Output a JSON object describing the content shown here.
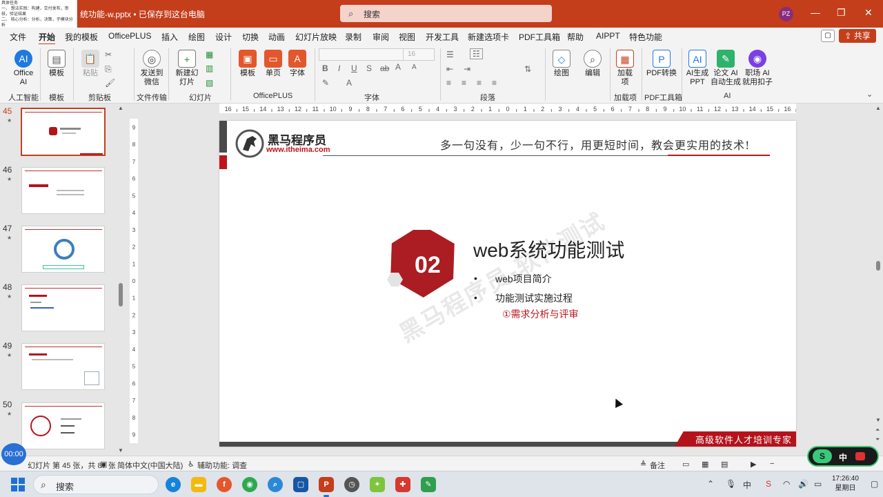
{
  "titlebar": {
    "filename": "统功能-w.pptx • 已保存到这台电脑",
    "search_placeholder": "搜索",
    "avatar": "PZ",
    "minimize": "—",
    "restore": "❐",
    "close": "✕",
    "popup_lines": [
      "具体任务",
      "一、 想法实践：构建，交付发布，审核，验证结果",
      "二、 核心分析：分析，决策，子模块分析"
    ]
  },
  "menu": {
    "tabs": [
      "文件",
      "开始",
      "我的模板",
      "OfficePLUS",
      "插入",
      "绘图",
      "设计",
      "切换",
      "动画",
      "幻灯片放映",
      "录制",
      "审阅",
      "视图",
      "开发工具",
      "新建选项卡",
      "PDF工具箱",
      "帮助",
      "AIPPT",
      "特色功能"
    ],
    "active": "开始",
    "share": "共享"
  },
  "ribbon": {
    "buttons": {
      "office_ai": "Office AI",
      "template": "模板",
      "paste": "粘贴",
      "send_wechat": "发送到微信",
      "new_slide": "新建幻灯片",
      "op_template": "模板",
      "single_page": "单页",
      "font_btn": "字体",
      "draw": "绘图",
      "edit": "编辑",
      "addins": "加载项",
      "pdf_convert": "PDF转换",
      "ai_ppt": "AI生成PPT",
      "lunwen_ai": "论文 AI自动生成",
      "zhichang_ai": "职场 AI就用扣子"
    },
    "groups": {
      "ai": "人工智能",
      "template": "模板",
      "clipboard": "剪贴板",
      "file_transfer": "文件传输",
      "slides": "幻灯片",
      "officeplus": "OfficePLUS",
      "font": "字体",
      "paragraph": "段落",
      "addins": "加载项",
      "pdf": "PDF工具箱",
      "ai2": "AI"
    },
    "font_size": "16",
    "format_buttons": [
      "B",
      "I",
      "U",
      "S",
      "ab",
      "A",
      "A"
    ]
  },
  "thumbnails": [
    {
      "num": "45",
      "active": true
    },
    {
      "num": "46",
      "active": false
    },
    {
      "num": "47",
      "active": false
    },
    {
      "num": "48",
      "active": false
    },
    {
      "num": "49",
      "active": false
    },
    {
      "num": "50",
      "active": false
    }
  ],
  "ruler": {
    "h_ticks": [
      "16",
      "15",
      "14",
      "13",
      "12",
      "11",
      "10",
      "9",
      "8",
      "7",
      "6",
      "5",
      "4",
      "3",
      "2",
      "1",
      "0",
      "1",
      "2",
      "3",
      "4",
      "5",
      "6",
      "7",
      "8",
      "9",
      "10",
      "11",
      "12",
      "13",
      "14",
      "15",
      "16"
    ],
    "v_ticks": [
      "9",
      "8",
      "7",
      "6",
      "5",
      "4",
      "3",
      "2",
      "1",
      "0",
      "1",
      "2",
      "3",
      "4",
      "5",
      "6",
      "7",
      "8",
      "9"
    ]
  },
  "slide": {
    "logo_name": "黑马程序员",
    "logo_url": "www.itheima.com",
    "slogan": "多一句没有，少一句不行，用更短时间，教会更实用的技术!",
    "section_number": "02",
    "section_title": "web系统功能测试",
    "bullets": [
      "web项目简介",
      "功能测试实施过程"
    ],
    "bullet_marker": "•",
    "sub_item": "①需求分析与评审",
    "watermark": "黑马程序员-软件测试",
    "footer": "高级软件人才培训专家"
  },
  "statusbar": {
    "slide_info": "幻灯片 第 45 张，共 87 张",
    "language": "简体中文(中国大陆)",
    "accessibility": "辅助功能: 调查",
    "notes": "备注"
  },
  "overlays": {
    "timer": "00:00",
    "ime_s": "S",
    "ime_zh": "中"
  },
  "taskbar": {
    "search": "搜索",
    "time": "17:26:40",
    "day": "星期日"
  },
  "colors": {
    "brand": "#c43e1c",
    "slide_red": "#c0141d",
    "dark_gray": "#4a4a4a"
  }
}
